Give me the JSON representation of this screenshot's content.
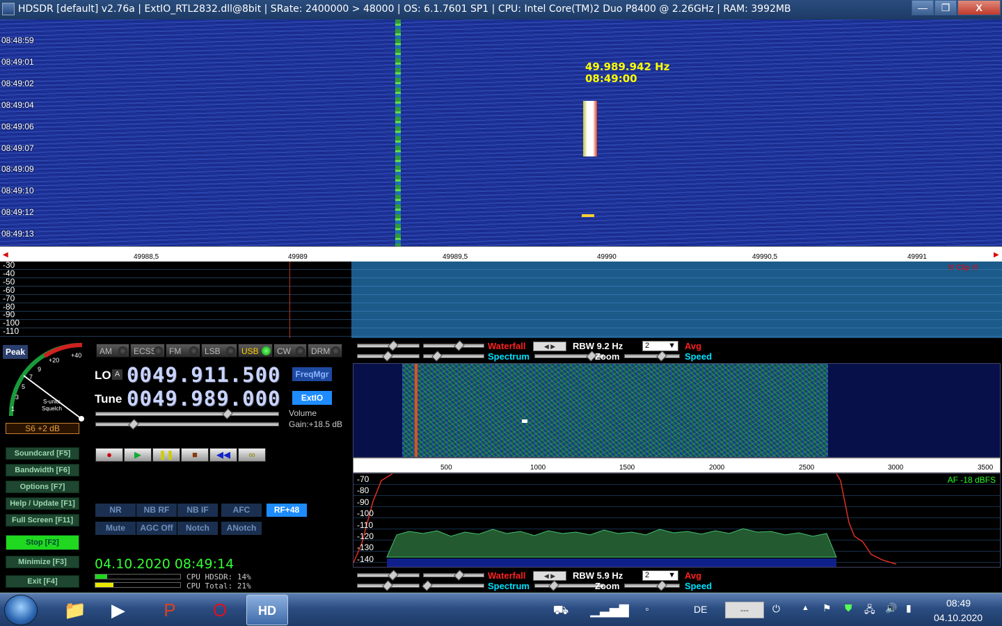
{
  "window": {
    "title": "HDSDR  [default]  v2.76a  |  ExtIO_RTL2832.dll@8bit  |  SRate: 2400000 > 48000  |  OS: 6.1.7601 SP1  |  CPU: Intel Core(TM)2 Duo     P8400  @ 2.26GHz  |  RAM: 3992MB",
    "minimize": "—",
    "maximize": "❐",
    "close": "X"
  },
  "waterfall": {
    "times": [
      "08:48:59",
      "08:49:01",
      "08:49:02",
      "08:49:04",
      "08:49:06",
      "08:49:07",
      "08:49:09",
      "08:49:10",
      "08:49:12",
      "08:49:13"
    ],
    "cursor_freq": "49.989.942 Hz",
    "cursor_time": "08:49:00"
  },
  "freq_scale": {
    "ticks": [
      "49988,5",
      "49989",
      "49989,5",
      "49990",
      "49990,5",
      "49991"
    ]
  },
  "rf_spectrum": {
    "db_labels": [
      "-30",
      "-40",
      "-50",
      "-60",
      "-70",
      "-80",
      "-90",
      "-100",
      "-110"
    ],
    "clip": "!!! Clip !!!"
  },
  "smeter": {
    "peak": "Peak",
    "scale": [
      "+40",
      "+20",
      "9",
      "7",
      "5",
      "3",
      "1"
    ],
    "sunits": "S-units",
    "squelch": "Squelch",
    "value": "S6 +2 dB"
  },
  "side_buttons": {
    "soundcard": "Soundcard  [F5]",
    "bandwidth": "Bandwidth  [F6]",
    "options": "Options    [F7]",
    "help": "Help / Update  [F1]",
    "fullscreen": "Full Screen  [F11]",
    "stop": "Stop       [F2]",
    "minimize": "Minimize  [F3]",
    "exit": "Exit       [F4]"
  },
  "modes": [
    "AM",
    "ECSS",
    "FM",
    "LSB",
    "USB",
    "CW",
    "DRM"
  ],
  "active_mode": "USB",
  "lo": {
    "label": "LO",
    "a": "A",
    "value": "0049.911.500"
  },
  "tune": {
    "label": "Tune",
    "value": "0049.989.000"
  },
  "buttons": {
    "freqmgr": "FreqMgr",
    "extio": "ExtIO"
  },
  "volume": {
    "label": "Volume",
    "gain": "Gain:+18.5 dB"
  },
  "recorder": {
    "record": "●",
    "play": "▶",
    "pause": "❚❚",
    "stop": "■",
    "rewind": "◀◀",
    "loop": "∞"
  },
  "dsp": {
    "row1": [
      "NR",
      "NB RF",
      "NB IF",
      "AFC",
      "RF+48"
    ],
    "row2": [
      "Mute",
      "AGC Off",
      "Notch",
      "ANotch"
    ]
  },
  "status": {
    "datetime": "04.10.2020 08:49:14",
    "cpu_hdsdr": "CPU HDSDR: 14%",
    "cpu_total": "CPU Total: 21%",
    "cpu_hdsdr_level": 0.14,
    "cpu_total_level": 0.21
  },
  "af_top_controls": {
    "waterfall": "Waterfall",
    "spectrum": "Spectrum",
    "rbw": "RBW  9.2 Hz",
    "zoom": "Zoom",
    "combo": "2",
    "avg": "Avg",
    "speed": "Speed"
  },
  "af_bottom_controls": {
    "waterfall": "Waterfall",
    "spectrum": "Spectrum",
    "rbw": "RBW  5.9 Hz",
    "zoom": "Zoom",
    "combo": "2",
    "avg": "Avg",
    "speed": "Speed"
  },
  "af_scale": {
    "ticks": [
      "500",
      "1000",
      "1500",
      "2000",
      "2500",
      "3000",
      "3500"
    ]
  },
  "af_spectrum": {
    "db_labels": [
      "-70",
      "-80",
      "-90",
      "-100",
      "-110",
      "-120",
      "-130",
      "-140"
    ],
    "level": "AF -18 dBFS"
  },
  "taskbar": {
    "lang": "DE",
    "box": "---",
    "time": "08:49",
    "date": "04.10.2020"
  },
  "colors": {
    "waterfall_bg": "#1a2c8f",
    "accent_blue": "#1e8cff",
    "stop_green": "#1fd81f",
    "af_level": "#22ff22",
    "waterfall_label": "#ff2020",
    "spectrum_label": "#00e0ff"
  }
}
